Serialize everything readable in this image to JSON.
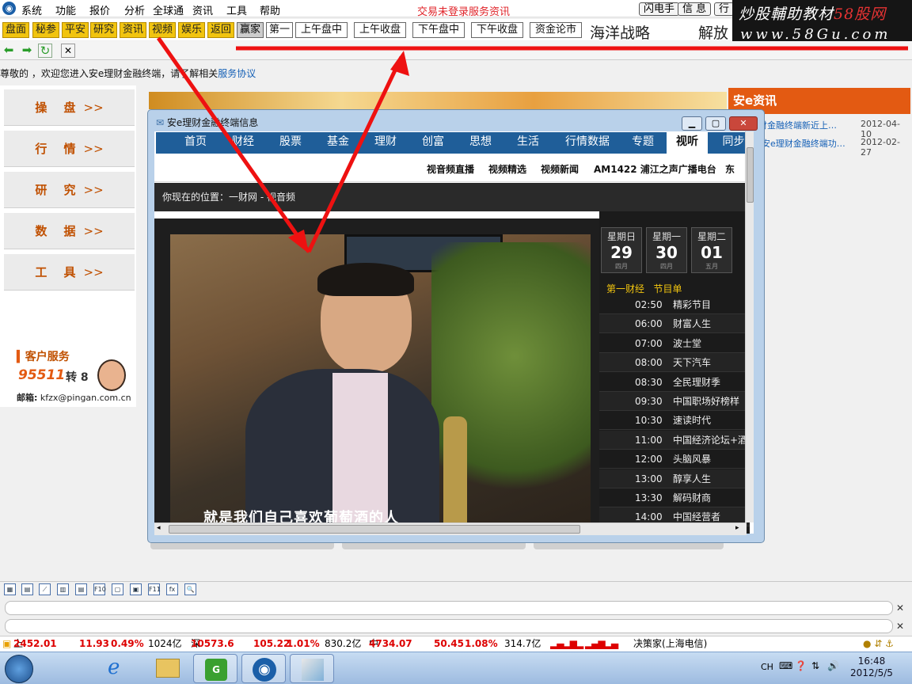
{
  "menubar": {
    "items": [
      "系统",
      "功能",
      "报价",
      "分析",
      "全球通",
      "资讯",
      "工具",
      "帮助"
    ],
    "trade_status": "交易未登录",
    "service_news": "服务资讯",
    "right_buttons": [
      "闪电手",
      "信 息",
      "行"
    ]
  },
  "watermark": {
    "line1_a": "炒股輔助教材",
    "line1_b": "58股网",
    "line2": "www.58Gu.com"
  },
  "toolbar": {
    "yellow": [
      "盘面",
      "秘参",
      "平安",
      "研究",
      "资讯",
      "视频",
      "娱乐",
      "返回"
    ],
    "white": [
      "赢家",
      "第一",
      "上午盘中",
      "上午收盘",
      "下午盘中",
      "下午收盘",
      "资金论市"
    ],
    "big_text_1": "海洋战略",
    "big_text_2": "解放"
  },
  "welcome": {
    "text": "尊敬的 ，欢迎您进入安e理财金融终端，请了解相关",
    "link": "服务协议"
  },
  "sidebar": {
    "items": [
      "操 盘",
      "行 情",
      "研 究",
      "数 据",
      "工 具"
    ],
    "arrow": ">>",
    "cs_title": "客户服务",
    "cs_phone": "95511",
    "cs_ext": "转 8",
    "cs_email_label": "邮箱:",
    "cs_email": "kfzx@pingan.com.cn"
  },
  "news": {
    "header": "安e资讯",
    "items": [
      {
        "title": "财金融终端新近上…",
        "date": "2012-04-10"
      },
      {
        "title": "安e理财金融终端功…",
        "date": "2012-02-27"
      }
    ]
  },
  "popup": {
    "title": "安e理财金融终端信息",
    "tabs": [
      "首页",
      "财经",
      "股票",
      "基金",
      "理财",
      "创富",
      "思想",
      "生活",
      "行情数据",
      "专题",
      "视听",
      "同步"
    ],
    "active_tab": "视听",
    "subnav": [
      "视音频直播",
      "视频精选",
      "视频新闻",
      "AM1422 浦江之声广播电台",
      "东"
    ],
    "breadcrumb": "你现在的位置：一财网 - 视音频",
    "video_subtitle": "就是我们自己喜欢葡萄酒的人",
    "days": [
      {
        "week": "星期日",
        "num": "29",
        "month": "四月"
      },
      {
        "week": "星期一",
        "num": "30",
        "month": "四月"
      },
      {
        "week": "星期二",
        "num": "01",
        "month": "五月"
      }
    ],
    "channel": "第一财经",
    "schedule_label": "节目单",
    "schedule": [
      {
        "time": "02:50",
        "name": "精彩节目"
      },
      {
        "time": "06:00",
        "name": "财富人生"
      },
      {
        "time": "07:00",
        "name": "波士堂"
      },
      {
        "time": "08:00",
        "name": "天下汽车"
      },
      {
        "time": "08:30",
        "name": "全民理财季"
      },
      {
        "time": "09:30",
        "name": "中国职场好榜样"
      },
      {
        "time": "10:30",
        "name": "速读时代"
      },
      {
        "time": "11:00",
        "name": "中国经济论坛+酒"
      },
      {
        "time": "12:00",
        "name": "头脑风暴"
      },
      {
        "time": "13:00",
        "name": "醇享人生"
      },
      {
        "time": "13:30",
        "name": "解码财商"
      },
      {
        "time": "14:00",
        "name": "中国经营者"
      }
    ]
  },
  "indexbar": {
    "sh_label": "上证",
    "sh_value": "2452.01",
    "sh_change": "11.93",
    "sh_pct": "0.49%",
    "sh_vol": "1024亿",
    "sz_label": "深证",
    "sz_value": "10573.6",
    "sz_change": "105.22",
    "sz_pct": "1.01%",
    "sz_vol": "830.2亿",
    "zx_label": "中小",
    "zx_value": "4734.07",
    "zx_change": "50.45",
    "zx_pct": "1.08%",
    "zx_vol": "314.7亿",
    "broker": "决策家(上海电信)"
  },
  "taskbar": {
    "lang": "CH",
    "time": "16:48",
    "date": "2012/5/5"
  },
  "colors": {
    "accent_orange": "#e35a12",
    "tab_blue": "#1f5e99",
    "toolbar_yellow": "#f1c40f",
    "annotation_red": "#ee1111"
  }
}
